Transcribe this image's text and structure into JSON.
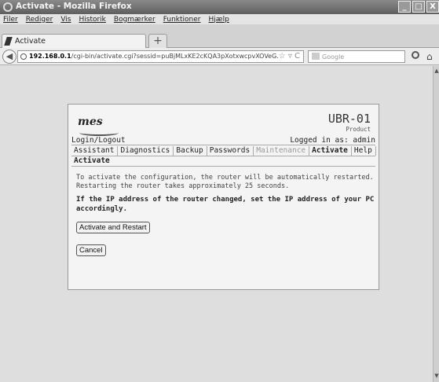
{
  "window": {
    "title": "Activate - Mozilla Firefox",
    "buttons": [
      "_",
      "□",
      "X"
    ]
  },
  "menubar": [
    "Filer",
    "Rediger",
    "Vis",
    "Historik",
    "Bogmærker",
    "Funktioner",
    "Hjælp"
  ],
  "tab": {
    "label": "Activate",
    "new_tab": "+"
  },
  "navbar": {
    "url_host": "192.168.0.1",
    "url_path": "/cgi-bin/activate.cgi?sessid=puBjMLxKE2cKQA3pXotxwcpvXOVeG.",
    "url_right_icons": "☆ ▿ C",
    "search_placeholder": "Google",
    "home_icon": "⌂"
  },
  "router": {
    "logo": "mes",
    "model": "UBR-01",
    "model_sub": "Product",
    "login_link": "Login/Logout",
    "logged_in": "Logged in as: admin",
    "tabs": [
      {
        "label": "Assistant",
        "state": "normal"
      },
      {
        "label": "Diagnostics",
        "state": "normal"
      },
      {
        "label": "Backup",
        "state": "normal"
      },
      {
        "label": "Passwords",
        "state": "normal"
      },
      {
        "label": "Maintenance",
        "state": "disabled"
      },
      {
        "label": "Activate",
        "state": "active"
      },
      {
        "label": "Help",
        "state": "normal"
      }
    ],
    "section_title": "Activate",
    "message_1": "To activate the configuration, the router will be automatically restarted. Restarting the router takes approximately 25 seconds.",
    "message_2": "If the IP address of the router changed, set the IP address of your PC accordingly.",
    "activate_button": "Activate and Restart",
    "cancel_button": "Cancel"
  }
}
